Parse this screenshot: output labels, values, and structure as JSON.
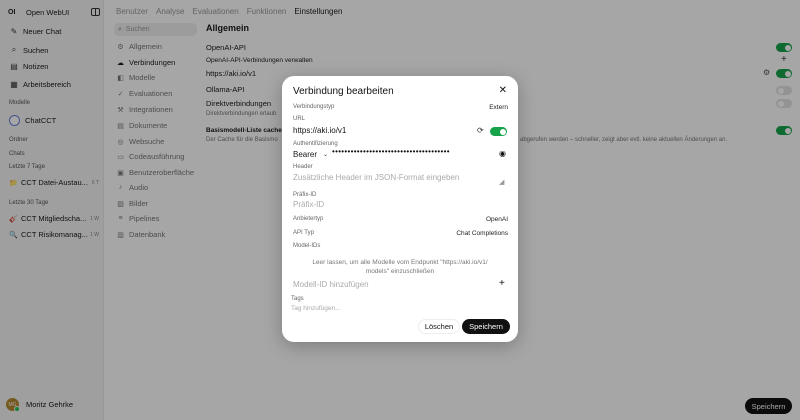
{
  "app": {
    "logo": "OI",
    "title": "Open WebUI"
  },
  "sidebar": {
    "nav": [
      {
        "icon": "✎",
        "label": "Neuer Chat"
      },
      {
        "icon": "⌕",
        "label": "Suchen"
      },
      {
        "icon": "▤",
        "label": "Notizen"
      },
      {
        "icon": "▦",
        "label": "Arbeitsbereich"
      }
    ],
    "models_heading": "Modelle",
    "model": "ChatCCT",
    "folders_heading": "Ordner",
    "chats_heading": "Chats",
    "group_7": "Letzte 7 Tage",
    "chats_7": [
      {
        "emoji": "📁",
        "title": "CCT Datei-Austau...",
        "age": "6 T"
      }
    ],
    "group_30": "Letzte 30 Tage",
    "chats_30": [
      {
        "emoji": "🎸",
        "title": "CCT Mitgliedscha...",
        "age": "1 W"
      },
      {
        "emoji": "🔍",
        "title": "CCT Risikomanag...",
        "age": "1 W"
      }
    ],
    "user": {
      "initials": "MG",
      "name": "Moritz Gehrke"
    }
  },
  "top_tabs": [
    "Benutzer",
    "Analyse",
    "Evaluationen",
    "Funktionen",
    "Einstellungen"
  ],
  "settings": {
    "search_placeholder": "Suchen",
    "nav": [
      {
        "icon": "⚙",
        "label": "Allgemein"
      },
      {
        "icon": "☁",
        "label": "Verbindungen"
      },
      {
        "icon": "◧",
        "label": "Modelle"
      },
      {
        "icon": "✓",
        "label": "Evaluationen"
      },
      {
        "icon": "⚒",
        "label": "Integrationen"
      },
      {
        "icon": "▤",
        "label": "Dokumente"
      },
      {
        "icon": "◎",
        "label": "Websuche"
      },
      {
        "icon": "▭",
        "label": "Codeausführung"
      },
      {
        "icon": "▣",
        "label": "Benutzeroberfläche"
      },
      {
        "icon": "♪",
        "label": "Audio"
      },
      {
        "icon": "▨",
        "label": "Bilder"
      },
      {
        "icon": "≡",
        "label": "Pipelines"
      },
      {
        "icon": "▥",
        "label": "Datenbank"
      }
    ]
  },
  "panel": {
    "title": "Allgemein",
    "openai_api": "OpenAI-API",
    "openai_manage": "OpenAI-API-Verbindungen verwalten",
    "connection_url": "https://aki.io/v1",
    "ollama_api": "Ollama-API",
    "direct_connections": "Direktverbindungen",
    "direct_desc": "Direktverbindungen erlaub",
    "cache_title": "Basismodell-Liste cachen",
    "cache_desc_left": "Der Cache für die Basismo",
    "cache_desc_right": "abgerufen werden – schneller, zeigt aber evtl. keine aktuellen Änderungen an.",
    "save": "Speichern"
  },
  "modal": {
    "title": "Verbindung bearbeiten",
    "close": "✕",
    "conn_type_label": "Verbindungstyp",
    "conn_type_value": "Extern",
    "url_label": "URL",
    "url_value": "https://aki.io/v1",
    "auth_label": "Authentifizierung",
    "auth_type": "Bearer",
    "auth_key": "••••••••••••••••••••••••••••••••••••••",
    "header_label": "Header",
    "header_placeholder": "Zusätzliche Header im JSON-Format eingeben",
    "prefix_label": "Präfix-ID",
    "prefix_placeholder": "Präfix-ID",
    "provider_label": "Anbietertyp",
    "provider_value": "OpenAI",
    "api_type_label": "API Typ",
    "api_type_value": "Chat Completions",
    "model_ids_label": "Model-IDs",
    "model_ids_hint": "Leer lassen, um alle Modelle vom Endpunkt \"https://aki.io/v1/ models\" einzuschließen",
    "model_add_placeholder": "Modell-ID hinzufügen",
    "tags_label": "Tags",
    "tags_placeholder": "Tag hinzufügen...",
    "delete": "Löschen",
    "save": "Speichern"
  }
}
